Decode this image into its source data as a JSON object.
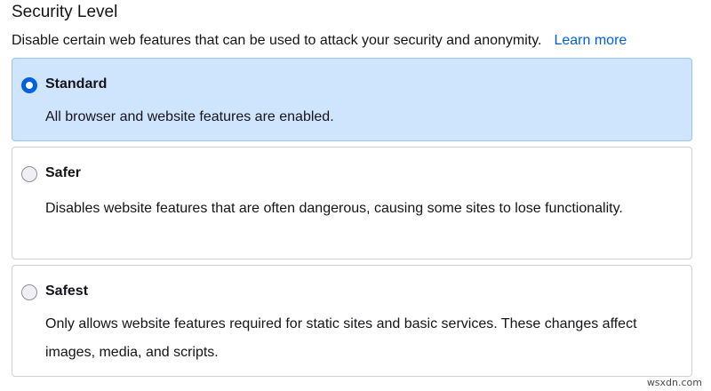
{
  "section": {
    "title": "Security Level",
    "description": "Disable certain web features that can be used to attack your security and anonymity.",
    "learn_more": "Learn more"
  },
  "options": [
    {
      "label": "Standard",
      "text": "All browser and website features are enabled.",
      "checked": true
    },
    {
      "label": "Safer",
      "text": "Disables website features that are often dangerous, causing some sites to lose functionality.",
      "checked": false
    },
    {
      "label": "Safest",
      "text": "Only allows website features required for static sites and basic services. These changes affect images, media, and scripts.",
      "checked": false
    }
  ],
  "watermark": "wsxdn.com",
  "colors": {
    "accent": "#0061e0",
    "selected_background": "#cfe5fd",
    "selected_border": "#9bc6f2",
    "border": "#cfcfd8",
    "text": "#15141a"
  }
}
